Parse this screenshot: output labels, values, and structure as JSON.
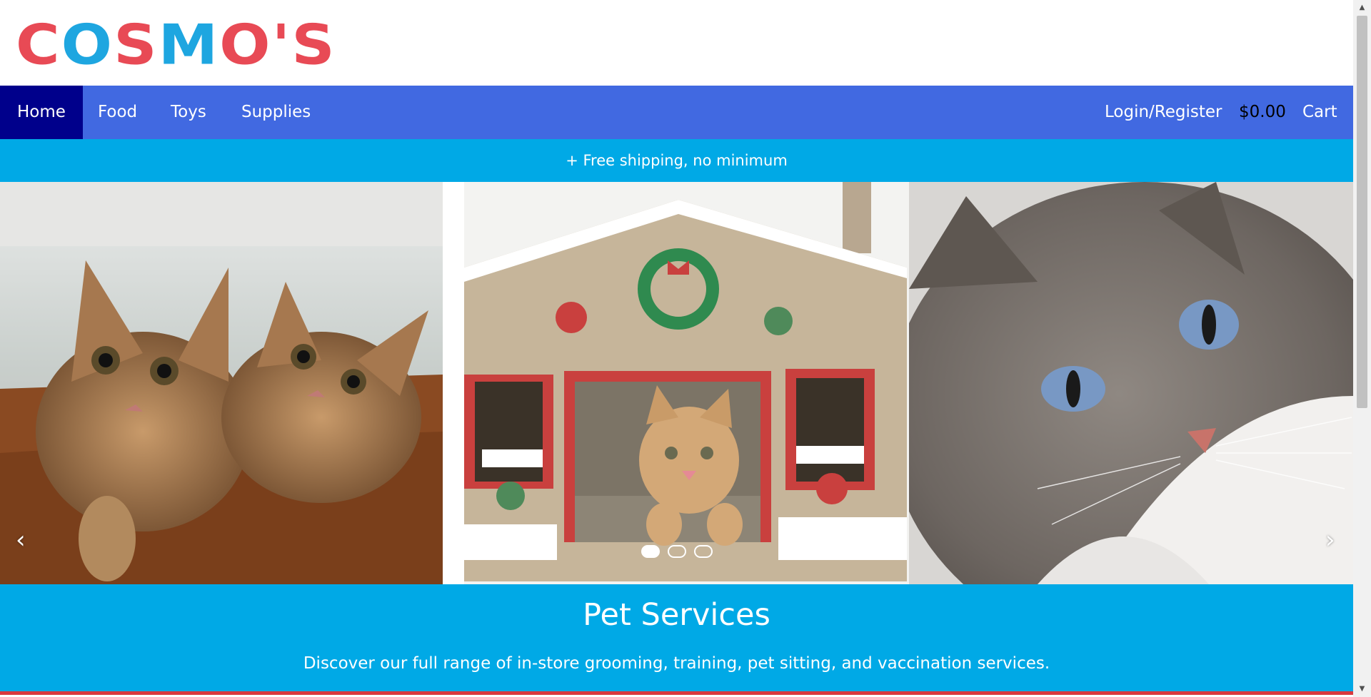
{
  "brand": {
    "logo_part1": "COSMO",
    "logo_part2": "'S"
  },
  "nav": {
    "items": [
      {
        "label": "Home"
      },
      {
        "label": "Food"
      },
      {
        "label": "Toys"
      },
      {
        "label": "Supplies"
      }
    ],
    "login": "Login/Register",
    "cart_amount": "$0.00",
    "cart": "Cart"
  },
  "promo": {
    "text": "+ Free shipping, no minimum"
  },
  "carousel": {
    "prev": "‹",
    "next": "›",
    "slide_count": 3,
    "active_slide": 1
  },
  "services": {
    "title": "Pet Services",
    "description": "Discover our full range of in-store grooming, training, pet sitting, and vaccination services."
  },
  "colors": {
    "nav_bg": "#4169e1",
    "nav_active": "#00008b",
    "promo_bg": "#00a9e6",
    "logo_red": "#e84a55",
    "logo_blue": "#1ea6e0"
  }
}
